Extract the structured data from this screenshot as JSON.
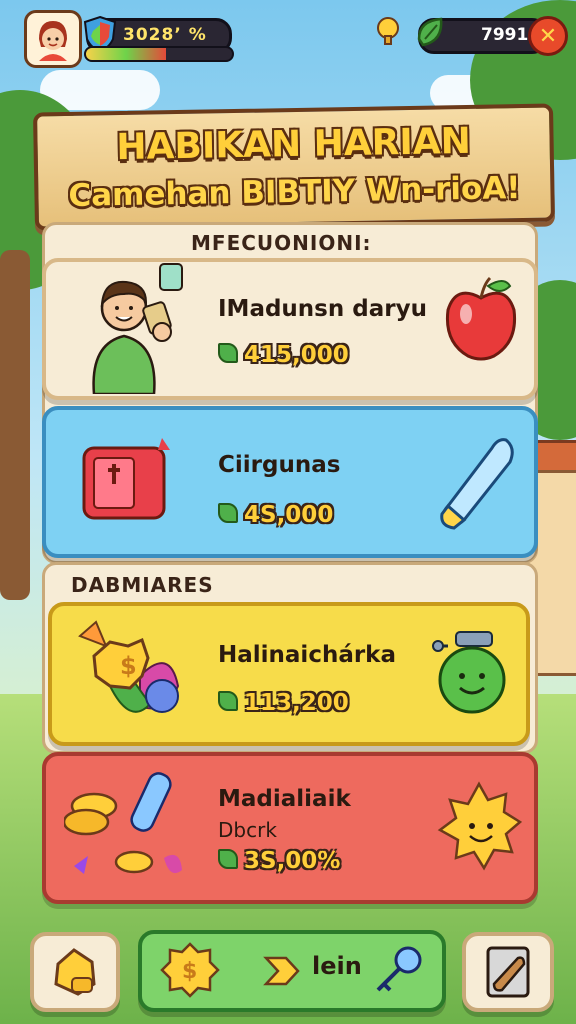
{
  "hud": {
    "level_text": "3028’ %",
    "xp_progress": 0.55,
    "currency_value": "7991",
    "close_symbol": "✕"
  },
  "title": {
    "main": "HABIKAN HARIAN",
    "subtitle": "Camehan BIBTIY Wn-rioA!"
  },
  "sections": {
    "first_label": "MFECUONIONI:",
    "second_label": "DABMIARES"
  },
  "cards": [
    {
      "title": "IMadunsn daryu",
      "value": "415,000",
      "icon": "apple-icon",
      "character": "boy-character",
      "bg": "#f7ecd6"
    },
    {
      "title": "Ciirgunas",
      "value": "4S,000",
      "icon": "crystal-icon",
      "character": "gift-box-icon",
      "bg": "#7ed1f3"
    },
    {
      "title": "Halinaichárka",
      "value": "113,200",
      "icon": "potion-icon",
      "character": "gem-coin-icon",
      "bg": "#f7dc4a"
    },
    {
      "title": "Madialiaik",
      "subtitle": "Dbcrk",
      "value": "3S,00%",
      "icon": "sun-icon",
      "character": "coins-icon",
      "bg": "#ee6a5e"
    }
  ],
  "bottom_bar": {
    "play_label": "lein",
    "left_icon": "bag-icon",
    "right_icon": "scroll-icon"
  },
  "colors": {
    "accent_gold": "#ffcf3a",
    "outline_brown": "#5a2e10",
    "play_green": "#7ed36a"
  }
}
